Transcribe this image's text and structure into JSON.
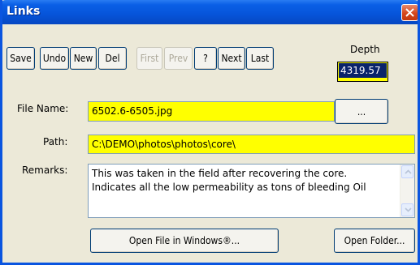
{
  "window": {
    "title": "Links"
  },
  "toolbar": {
    "save": "Save",
    "undo": "Undo",
    "new": "New",
    "del": "Del",
    "first": "First",
    "prev": "Prev",
    "help": "?",
    "next": "Next",
    "last": "Last"
  },
  "depth": {
    "label": "Depth",
    "value": "4319.57"
  },
  "form": {
    "file_name_label": "File Name:",
    "file_name_value": "6502.6-6505.jpg",
    "browse_label": "...",
    "path_label": "Path:",
    "path_value": "C:\\DEMO\\photos\\photos\\core\\",
    "remarks_label": "Remarks:",
    "remarks_line1": "This was taken in the field after recovering the core.",
    "remarks_line2": "Indicates all the low permeability as tons of bleeding Oil"
  },
  "actions": {
    "open_file": "Open File in Windows®...",
    "open_folder": "Open Folder..."
  },
  "colors": {
    "titlebar": "#0654d9",
    "field_highlight": "#ffff00",
    "dialog_bg": "#ece9d8",
    "close_button": "#d4461c"
  }
}
